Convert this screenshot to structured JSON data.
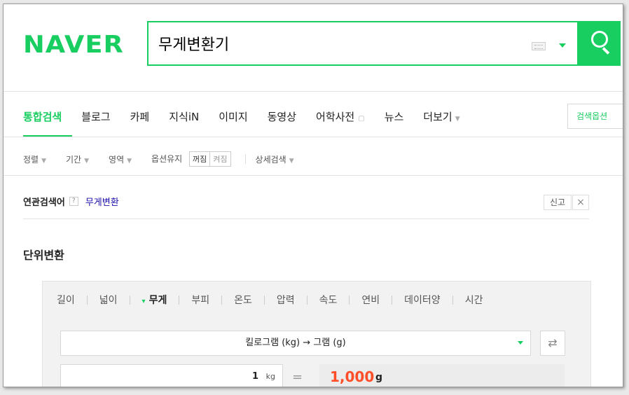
{
  "logo": "NAVER",
  "search": {
    "query": "무게변환기"
  },
  "tabs": {
    "items": [
      "통합검색",
      "블로그",
      "카페",
      "지식iN",
      "이미지",
      "동영상",
      "어학사전",
      "뉴스",
      "더보기"
    ],
    "option_button": "검색옵션"
  },
  "filters": {
    "sort": "정렬",
    "period": "기간",
    "area": "영역",
    "keep_option": "옵션유지",
    "off": "꺼짐",
    "on": "켜짐",
    "detail": "상세검색"
  },
  "related": {
    "title": "연관검색어",
    "help": "?",
    "link": "무게변환",
    "report": "신고",
    "close": "×"
  },
  "converter": {
    "title": "단위변환",
    "unit_tabs": [
      "길이",
      "넓이",
      "무게",
      "부피",
      "온도",
      "압력",
      "속도",
      "연비",
      "데이터양",
      "시간"
    ],
    "active_tab": "무게",
    "conversion": "킬로그램 (kg) → 그램 (g)",
    "swap": "⇄",
    "input_value": "1",
    "input_unit": "kg",
    "equals": "=",
    "result_value": "1,000",
    "result_unit": "g"
  },
  "colors": {
    "brand": "#19ce60",
    "result": "#ff4e28"
  }
}
